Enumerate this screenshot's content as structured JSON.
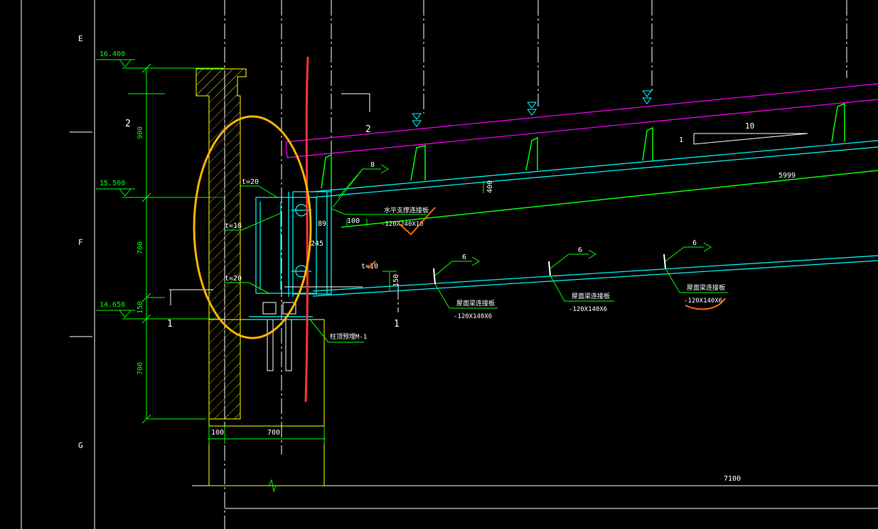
{
  "axis_labels": {
    "e": "E",
    "f": "F",
    "g": "G"
  },
  "elevations": {
    "top": "16.400",
    "mid": "15.500",
    "bottom": "14.650"
  },
  "dimensions": {
    "d900": "900",
    "d700_upper": "700",
    "d150": "150",
    "d700_lower": "700",
    "d100_base": "100",
    "d700_base": "700",
    "d100_plate": "100",
    "d89": "89",
    "d245": "245",
    "d400": "400",
    "d150_web": "150",
    "span_5999": "5999",
    "span_7100": "7100"
  },
  "section_marks": {
    "left_2": "2",
    "right_2": "2",
    "left_1": "1",
    "right_1": "1"
  },
  "slope": {
    "one": "1",
    "ten": "10"
  },
  "plate_thickness": {
    "t20_top": "t=20",
    "t18": "t=18",
    "t20_bottom": "t=20",
    "t10": "t=10"
  },
  "welds": {
    "w8": "8",
    "w6a": "6",
    "w6b": "6",
    "w6c": "6"
  },
  "notes": {
    "horizontal_plate_name": "水平支撑连接板",
    "horizontal_plate_spec": "-120X240X10",
    "roof_plate_name_1": "屋面梁连接板",
    "roof_plate_spec_1": "-120X140X6",
    "roof_plate_name_2": "屋面梁连接板",
    "roof_plate_spec_2": "-120X140X6",
    "roof_plate_name_3": "屋面梁连接板",
    "roof_plate_spec_3": "-120X140X6",
    "embed_name": "柱顶预埋M-1"
  },
  "colors": {
    "background": "#000000",
    "linework": "#ffffff",
    "concrete": "#ffff00",
    "dimension": "#00ff00",
    "steel": "#00ffff",
    "roof_sheet": "#ff00ff",
    "markup_red": "#ff3333",
    "markup_orange": "#ffb400"
  }
}
